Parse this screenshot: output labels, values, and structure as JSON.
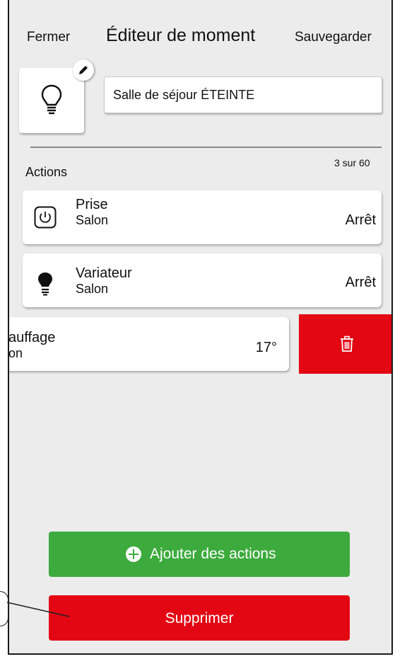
{
  "header": {
    "close_label": "Fermer",
    "title": "Éditeur de moment",
    "save_label": "Sauvegarder"
  },
  "moment": {
    "icon": "lightbulb-icon",
    "edit_icon": "pencil-icon",
    "name": "Salle de séjour ÉTEINTE"
  },
  "actions": {
    "label": "Actions",
    "count": "3 sur 60",
    "items": [
      {
        "icon": "power-icon",
        "title": "Prise",
        "room": "Salon",
        "value": "Arrêt"
      },
      {
        "icon": "bulb-dimmer-icon",
        "title": "Variateur",
        "room": "Salon",
        "value": "Arrêt"
      },
      {
        "icon": "thermostat-icon",
        "title": "auffage",
        "room": "on",
        "value": "17°"
      }
    ],
    "delete_icon": "trash-icon"
  },
  "buttons": {
    "add_label": "Ajouter des actions",
    "delete_label": "Supprimer"
  },
  "colors": {
    "green": "#3caa3c",
    "red": "#e30613",
    "background": "#ececec"
  }
}
